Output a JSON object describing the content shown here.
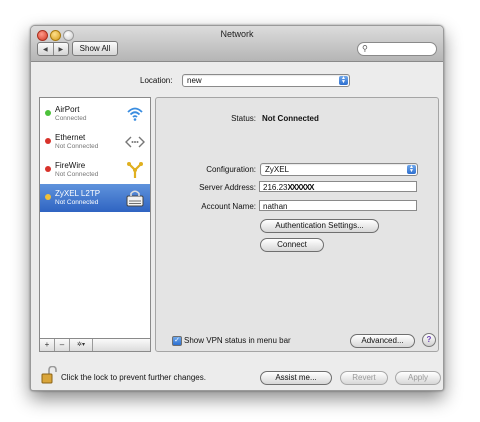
{
  "window": {
    "title": "Network",
    "nav_back": "◀",
    "nav_forward": "▶",
    "show_all_label": "Show All",
    "search_placeholder": "",
    "search_icon": "search-icon"
  },
  "location": {
    "label": "Location:",
    "value": "new",
    "popup_arrows": "▲▼"
  },
  "services": [
    {
      "name": "AirPort",
      "status": "Connected",
      "dot_color": "#4cc13a",
      "icon": "wifi-icon"
    },
    {
      "name": "Ethernet",
      "status": "Not Connected",
      "dot_color": "#d8322a",
      "icon": "ethernet-icon"
    },
    {
      "name": "FireWire",
      "status": "Not Connected",
      "dot_color": "#d8322a",
      "icon": "firewire-icon"
    },
    {
      "name": "ZyXEL L2TP",
      "status": "Not Connected",
      "dot_color": "#f0c038",
      "icon": "vpn-lock-icon",
      "selected": true
    }
  ],
  "list_toolbar": {
    "add_label": "+",
    "remove_label": "–",
    "action_label": "✲▾"
  },
  "detail": {
    "status_label": "Status:",
    "status_value": "Not Connected",
    "configuration_label": "Configuration:",
    "configuration_value": "ZyXEL",
    "server_address_label": "Server Address:",
    "server_address_value": "216.23",
    "server_address_redacted": "XXXXXX",
    "account_name_label": "Account Name:",
    "account_name_value": "nathan",
    "auth_settings_button": "Authentication Settings...",
    "connect_button": "Connect",
    "show_vpn_label": "Show VPN status in menu bar",
    "show_vpn_checked": "✓",
    "advanced_button": "Advanced...",
    "help_label": "?"
  },
  "footer": {
    "lock_text": "Click the lock to prevent further changes.",
    "assist_button": "Assist me...",
    "revert_button": "Revert",
    "apply_button": "Apply"
  },
  "colors": {
    "selection": "#3a6fcc",
    "window_bg": "#ececec",
    "redaction": "#111111"
  }
}
